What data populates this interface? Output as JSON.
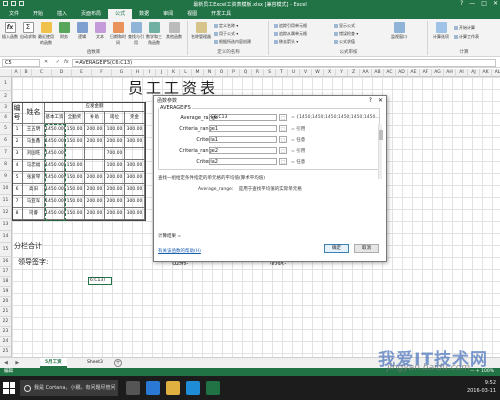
{
  "window": {
    "title": "最新员工Excel工资表模板.xlsx [兼容模式] - Excel",
    "controls": [
      "?",
      "—",
      "□",
      "✕"
    ]
  },
  "ribbon_tabs": [
    "文件",
    "开始",
    "插入",
    "页面布局",
    "公式",
    "数据",
    "审阅",
    "视图",
    "开发工具"
  ],
  "ribbon": {
    "groups": [
      {
        "label": "函数库",
        "buttons": [
          "插入函数",
          "自动求和",
          "最近使用的函数",
          "财务",
          "逻辑",
          "文本",
          "日期和时间",
          "查找与引用",
          "数学和三角函数",
          "其他函数"
        ]
      },
      {
        "label": "定义的名称",
        "buttons": [
          "名称管理器"
        ],
        "small": [
          "定义名称 ▾",
          "用于公式 ▾",
          "根据所选内容创建"
        ]
      },
      {
        "label": "公式审核",
        "small": [
          "追踪引用单元格",
          "追踪从属单元格",
          "移去箭头 ▾",
          "显示公式",
          "错误检查 ▾",
          "公式求值"
        ],
        "buttons": [
          "监视窗口"
        ]
      },
      {
        "label": "计算",
        "buttons": [
          "计算选项"
        ],
        "small": [
          "开始计算",
          "计算工作表"
        ]
      }
    ]
  },
  "formula_bar": {
    "name_box": "C5",
    "buttons": "✕ ✓",
    "fx": "fx",
    "formula": "=AVERAGEIFS(C6:C13)"
  },
  "grid": {
    "columns": [
      "A",
      "B",
      "C",
      "D",
      "E",
      "F",
      "G",
      "H",
      "I",
      "J",
      "K",
      "L",
      "M",
      "N",
      "O",
      "P",
      "Q",
      "R",
      "S",
      "T",
      "U",
      "V",
      "W",
      "X",
      "Y",
      "Z",
      "AA",
      "AB",
      "AC",
      "AD",
      "AE",
      "AF",
      "AG",
      "AH",
      "AI",
      "AJ",
      "AK",
      "AL",
      "AM",
      "AN",
      "AO",
      "AP",
      "AQ",
      "AR",
      "AS",
      "AT",
      "AU",
      "AV"
    ],
    "rows": [
      "1",
      "2",
      "3",
      "4",
      "5",
      "6",
      "7",
      "8",
      "9",
      "10",
      "11",
      "12",
      "13",
      "14",
      "15",
      "16",
      "17",
      "18",
      "19",
      "20",
      "21",
      "22",
      "23",
      "24",
      "25",
      "26",
      "27",
      "28",
      "29",
      "30"
    ],
    "big_title": "员工工资表"
  },
  "salary_table": {
    "header_number": "编号",
    "header_name": "姓名",
    "header_group": "应发金额",
    "sub_headers": [
      "基本工资",
      "全勤奖",
      "补助",
      "岗位",
      "奖金"
    ],
    "rows": [
      {
        "no": "1",
        "name": "王五明",
        "values": [
          "1450.00",
          "150.00",
          "200.00",
          "100.00",
          "300.00"
        ]
      },
      {
        "no": "2",
        "name": "马鱼鑫",
        "values": [
          "1450.00",
          "150.00",
          "200.00",
          "200.00",
          "300.00"
        ]
      },
      {
        "no": "3",
        "name": "刘国旺",
        "values": [
          "1450.00",
          "",
          "",
          "700.00",
          ""
        ]
      },
      {
        "no": "4",
        "name": "马忠福",
        "values": [
          "1450.00",
          "150.00",
          "",
          "100.00",
          "300.00"
        ]
      },
      {
        "no": "5",
        "name": "张爱琴",
        "values": [
          "1450.00",
          "150.00",
          "200.00",
          "200.00",
          "300.00"
        ]
      },
      {
        "no": "6",
        "name": "高旧",
        "values": [
          "1450.00",
          "150.00",
          "200.00",
          "200.00",
          "300.00"
        ]
      },
      {
        "no": "7",
        "name": "马亚军",
        "values": [
          "1450.00",
          "150.00",
          "200.00",
          "200.00",
          "300.00"
        ]
      },
      {
        "no": "8",
        "name": "司睿",
        "values": [
          "1450.00",
          "150.00",
          "200.00",
          "200.00",
          "300.00"
        ]
      }
    ],
    "subtotal_label": "分栏合计",
    "footer_sign": "领导签字:",
    "footer_cashier": "出纳:",
    "footer_maker": "制表:",
    "selected_cell_text": "6:C13)"
  },
  "dialog": {
    "title": "函数参数",
    "title_buttons": [
      "?",
      "✕"
    ],
    "function_name": "AVERAGEIFS",
    "arguments": [
      {
        "label": "Average_range",
        "value": "C6:C13",
        "result": "= {1450;1450;1450;1450;1450;1450..."
      },
      {
        "label": "Criteria_range1",
        "value": "",
        "result": "= 引用"
      },
      {
        "label": "Criteria1",
        "value": "",
        "result": "= 任意"
      },
      {
        "label": "Criteria_range2",
        "value": "",
        "result": "= 引用"
      },
      {
        "label": "Criteria2",
        "value": "",
        "result": "= 任意"
      }
    ],
    "description": "查找一组给定条件指定的单元格的平均值(算术平均值)",
    "param_label": "Average_range:",
    "param_description": "是用于查找平均值的实际单元格",
    "result_label": "计算结果 =",
    "help_link": "有关该函数的帮助(H)",
    "ok_label": "确定",
    "cancel_label": "取消"
  },
  "sheet_tabs": {
    "nav": "◀ ▶",
    "tabs": [
      "5月工资",
      "Sheet3"
    ],
    "active": "5月工资",
    "add": "+"
  },
  "status_bar": {
    "mode": "编辑",
    "zoom": "— + 100%"
  },
  "taskbar": {
    "cortana_placeholder": "我是 Cortana，小娜。有问题尽管问我。",
    "time": "9:52",
    "date": "2016-03-11"
  },
  "watermark": {
    "main": "我爱IT技术网",
    "url": "jingyan.baidu.com"
  },
  "colors": {
    "excel_green": "#217346",
    "ribbon_bg": "#f3f3f3",
    "taskbar": "#1c1c1c"
  }
}
